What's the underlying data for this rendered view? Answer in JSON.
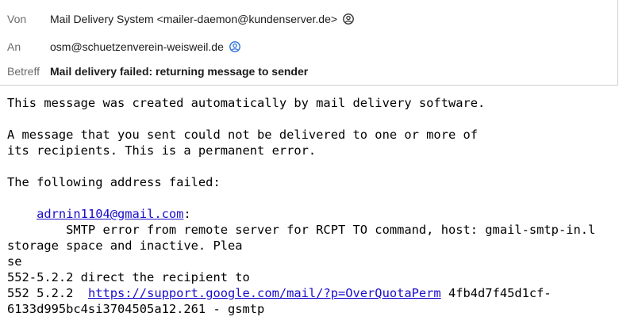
{
  "header": {
    "from_label": "Von",
    "from_value": "Mail Delivery System <mailer-daemon@kundenserver.de>",
    "from_icon": "contact-card-icon",
    "to_label": "An",
    "to_value": "osm@schuetzenverein-weisweil.de",
    "to_icon": "contact-card-icon",
    "subject_label": "Betreff",
    "subject_value": "Mail delivery failed: returning message to sender"
  },
  "body": {
    "line1": "This message was created automatically by mail delivery software.",
    "line2": "A message that you sent could not be delivered to one or more of",
    "line3": "its recipients. This is a permanent error.",
    "line4": "The following address failed:",
    "failed_address": "adrnin1104@gmail.com",
    "address_suffix": ":",
    "line6": "        SMTP error from remote server for RCPT TO command, host: gmail-smtp-in.l",
    "line7": "storage space and inactive. Plea",
    "line8": "se",
    "line9": "552-5.2.2 direct the recipient to",
    "line10_prefix": "552 5.2.2  ",
    "support_link": "https://support.google.com/mail/?p=OverQuotaPerm",
    "line10_suffix": " 4fb4d7f45d1cf-",
    "line11": "6133d995bc4si3704505a12.261 - gsmtp"
  },
  "colors": {
    "link": "#1a0dcc",
    "label": "#6b6b6b",
    "contact_icon_from": "#333333",
    "contact_icon_to": "#2a6fd6"
  }
}
